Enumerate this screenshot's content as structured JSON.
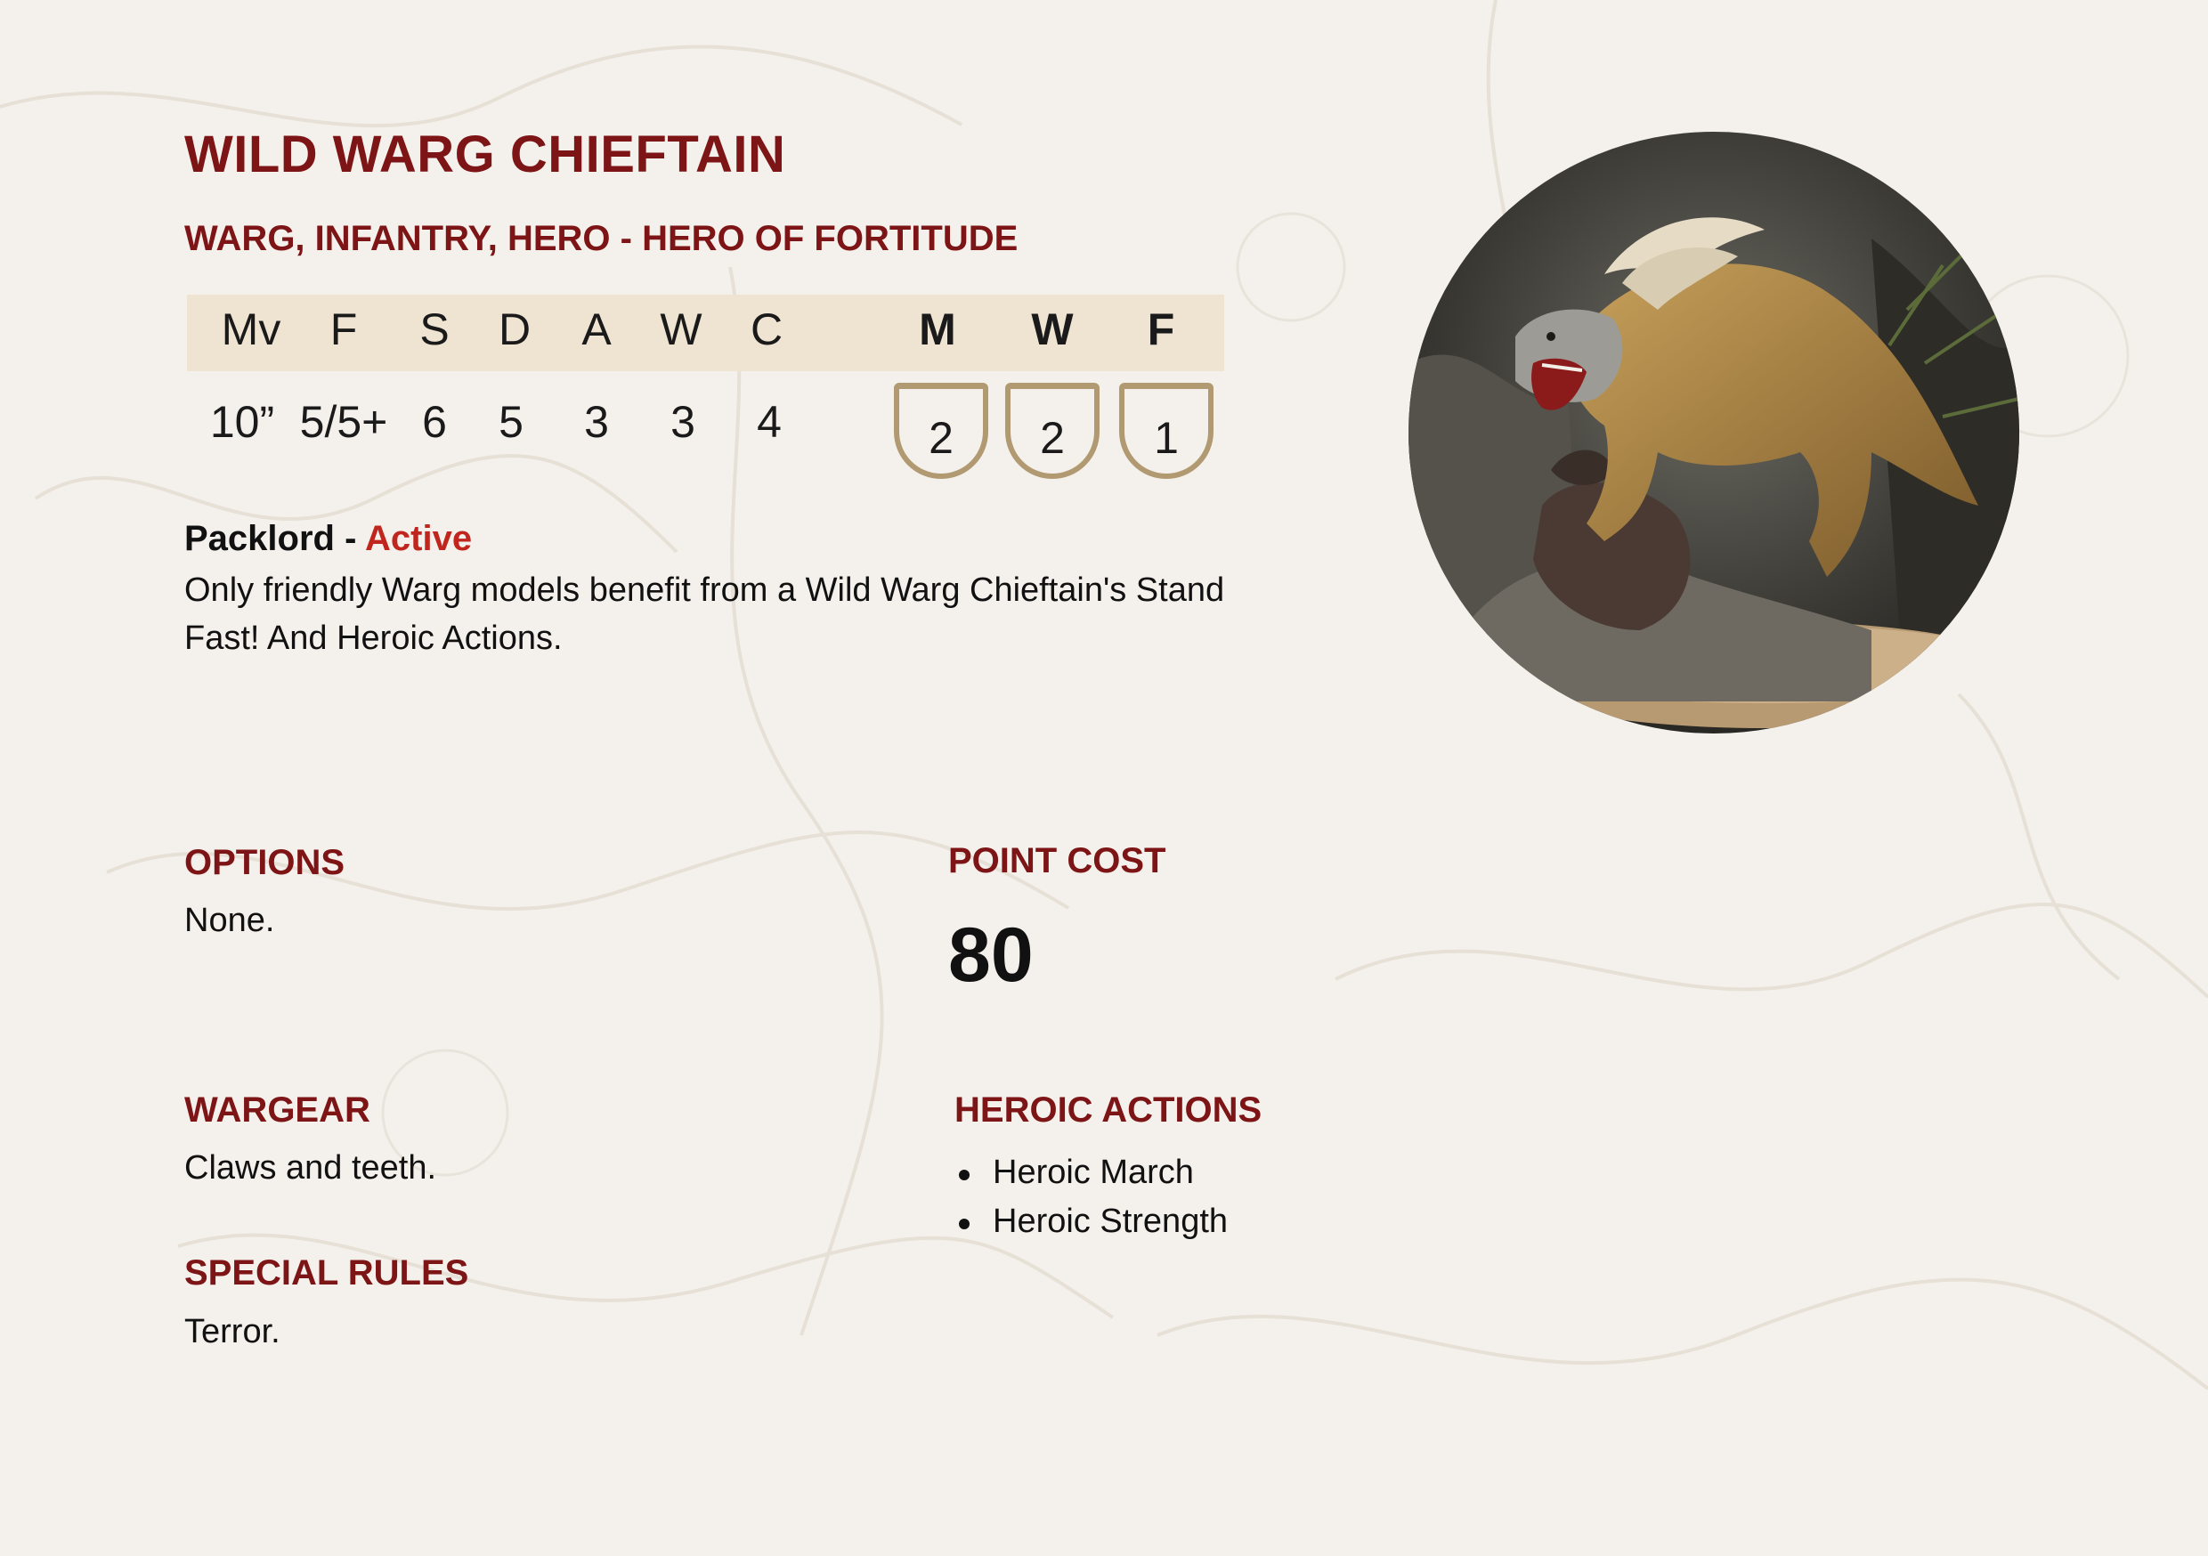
{
  "card": {
    "name": "WILD WARG CHIEFTAIN",
    "keywords": "WARG, INFANTRY, HERO - HERO OF FORTITUDE"
  },
  "stats": {
    "headers": [
      "Mv",
      "F",
      "S",
      "D",
      "A",
      "W",
      "C"
    ],
    "values": [
      "10”",
      "5/5+",
      "6",
      "5",
      "3",
      "3",
      "4"
    ],
    "hero_headers": [
      "M",
      "W",
      "F"
    ],
    "hero_values": [
      "2",
      "2",
      "1"
    ]
  },
  "special_rule": {
    "name": "Packlord",
    "separator": " - ",
    "type": "Active",
    "text": "Only friendly Warg models benefit from a Wild Warg Chieftain's Stand Fast! And Heroic Actions."
  },
  "options": {
    "heading": "OPTIONS",
    "text": "None."
  },
  "point_cost": {
    "heading": "POINT COST",
    "value": "80"
  },
  "wargear": {
    "heading": "WARGEAR",
    "text": "Claws and teeth."
  },
  "special_rules": {
    "heading": "SPECIAL RULES",
    "text": "Terror."
  },
  "heroic_actions": {
    "heading": "HEROIC ACTIONS",
    "items": [
      "Heroic March",
      "Heroic Strength"
    ]
  },
  "colors": {
    "background": "#f4f1ec",
    "heading": "#7d1416",
    "active": "#c0261e",
    "stat_band": "#efe3d1",
    "shield_border": "#b19a72"
  }
}
